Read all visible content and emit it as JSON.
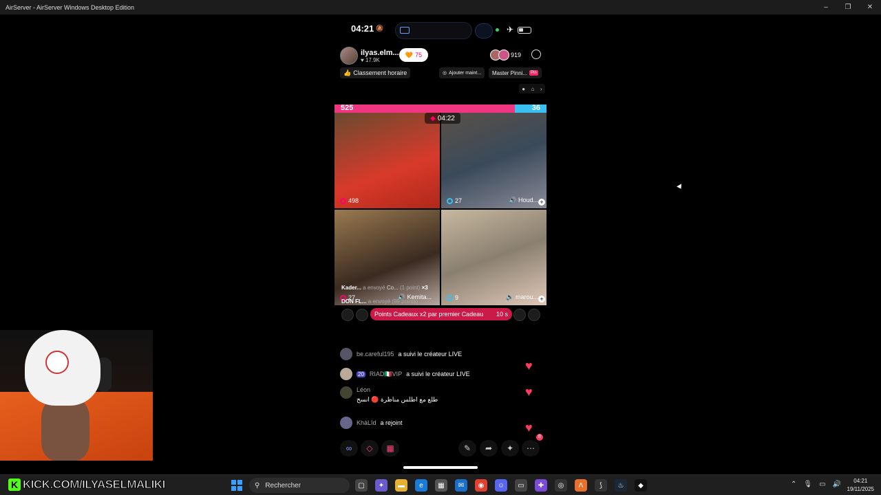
{
  "window": {
    "title": "AirServer - AirServer Windows Desktop Edition",
    "min": "–",
    "max": "❐",
    "close": "✕"
  },
  "phone": {
    "time": "04:21",
    "host": {
      "name": "ilyas.elm...",
      "likes": "♥ 17.9K",
      "follow_count": "75"
    },
    "viewers": "919",
    "chips": {
      "ranking": "Classement horaire",
      "add": "Ajouter maint...",
      "master": "Master Pinni...",
      "pin_tag": "Pin"
    },
    "battle": {
      "left_score": "525",
      "right_score": "36",
      "timer": "04:22"
    },
    "tiles": [
      {
        "score": "498",
        "name": ""
      },
      {
        "score": "27",
        "name": "Houd..."
      },
      {
        "score": "27",
        "name": "Kemita..."
      },
      {
        "score": "9",
        "name": "marou..."
      }
    ],
    "gifts": [
      {
        "user": "Kader...",
        "action": "a envoyé",
        "detail": "Co...",
        "points": "(1 point)",
        "multi": "×3"
      },
      {
        "user": "DON FL...",
        "action": "a envoyé",
        "detail": "",
        "points": "(99 points)",
        "multi": ""
      }
    ],
    "promo": {
      "text": "Points Cadeaux x2 par premier Cadeau",
      "timer": "10 s"
    },
    "chat": [
      {
        "user": "be.careful195",
        "text": "a suivi le créateur LIVE"
      },
      {
        "user": "RIAD🇮🇹VIP",
        "badge": "20",
        "text": "a suivi le créateur LIVE"
      },
      {
        "user": "Léon",
        "text": "طلع مع اطلس مناظرة 🔴 انسخ"
      },
      {
        "user": "KhàLîd",
        "text": "a rejoint"
      }
    ],
    "notif": "8"
  },
  "taskbar": {
    "kick_url": "KICK.COM/ILYASELMALIKI",
    "search_placeholder": "Rechercher",
    "time": "04:21",
    "date": "19/11/2025"
  }
}
